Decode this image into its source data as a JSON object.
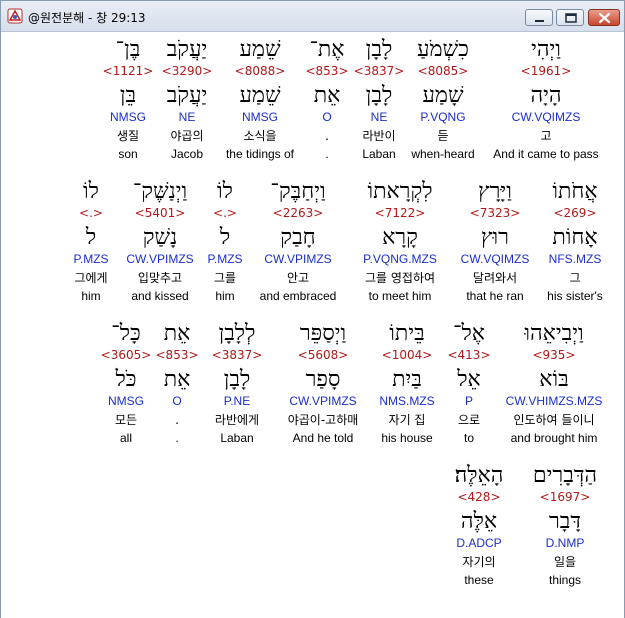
{
  "window": {
    "title": "@원전분해 - 창 29:13"
  },
  "rows": [
    {
      "words": [
        {
          "heb": "וַיְהִי",
          "strong": "<1961>",
          "lemma": "הָיָה",
          "parse": "CW.VQIMZS",
          "korean": "고",
          "english": "And it came to pass",
          "selected": true
        },
        {
          "heb": "כִשְׁמֹעַ",
          "strong": "<8085>",
          "lemma": "שָׁמַע",
          "parse": "P.VQNG",
          "korean": "듣",
          "english": "when-heard"
        },
        {
          "heb": "לָבָן",
          "strong": "<3837>",
          "lemma": "לָבָן",
          "parse": "NE",
          "korean": "라반이",
          "english": "Laban"
        },
        {
          "heb": "אֶת־",
          "strong": "<853>",
          "lemma": "אֵת",
          "parse": "O",
          "korean": ".",
          "english": "."
        },
        {
          "heb": "שֵׁמַע",
          "strong": "<8088>",
          "lemma": "שֵׁמַע",
          "parse": "NMSG",
          "korean": "소식을",
          "english": "the tidings of"
        },
        {
          "heb": "יַעֲקֹב",
          "strong": "<3290>",
          "lemma": "יַעֲקֹב",
          "parse": "NE",
          "korean": "야곱의",
          "english": "Jacob"
        },
        {
          "heb": "בֶּן־",
          "strong": "<1121>",
          "lemma": "בֵּן",
          "parse": "NMSG",
          "korean": "생질",
          "english": "son"
        }
      ]
    },
    {
      "words": [
        {
          "heb": "אֲחֹתוֹ",
          "strong": "<269>",
          "lemma": "אָחוֹת",
          "parse": "NFS.MZS",
          "korean": "그",
          "english": "his sister's"
        },
        {
          "heb": "וַיָּרָץ",
          "strong": "<7323>",
          "lemma": "רוּץ",
          "parse": "CW.VQIMZS",
          "korean": "달려와서",
          "english": "that he ran"
        },
        {
          "heb": "לִקְרָאתוֹ",
          "strong": "<7122>",
          "lemma": "קָרָא",
          "parse": "P.VQNG.MZS",
          "korean": "그를 영접하여",
          "english": "to meet him"
        },
        {
          "heb": "וַיְחַבֶּק־",
          "strong": "<2263>",
          "lemma": "חָבַק",
          "parse": "CW.VPIMZS",
          "korean": "안고",
          "english": "and embraced"
        },
        {
          "heb": "לוֹ",
          "strong": "<.>",
          "lemma": "ל",
          "parse": "P.MZS",
          "korean": "그를",
          "english": "him"
        },
        {
          "heb": "וַיְנַשֶּׁק־",
          "strong": "<5401>",
          "lemma": "נָשַׁק",
          "parse": "CW.VPIMZS",
          "korean": "입맞추고",
          "english": "and kissed"
        },
        {
          "heb": "לוֹ",
          "strong": "<.>",
          "lemma": "ל",
          "parse": "P.MZS",
          "korean": "그에게",
          "english": "him"
        }
      ]
    },
    {
      "words": [
        {
          "heb": "וַיְבִיאֵהוּ",
          "strong": "<935>",
          "lemma": "בּוֹא",
          "parse": "CW.VHIMZS.MZS",
          "korean": "인도하여 들이니",
          "english": "and brought him"
        },
        {
          "heb": "אֶל־",
          "strong": "<413>",
          "lemma": "אֵל",
          "parse": "P",
          "korean": "으로",
          "english": "to"
        },
        {
          "heb": "בֵּיתוֹ",
          "strong": "<1004>",
          "lemma": "בַּיִת",
          "parse": "NMS.MZS",
          "korean": "자기 집",
          "english": "his house"
        },
        {
          "heb": "וַיְסַפֵּר",
          "strong": "<5608>",
          "lemma": "סָפַר",
          "parse": "CW.VPIMZS",
          "korean": "야곱이-고하매",
          "english": "And he told"
        },
        {
          "heb": "לְלָבָן",
          "strong": "<3837>",
          "lemma": "לָבָן",
          "parse": "P.NE",
          "korean": "라반에게",
          "english": "Laban"
        },
        {
          "heb": "אֵת",
          "strong": "<853>",
          "lemma": "אֵת",
          "parse": "O",
          "korean": ".",
          "english": "."
        },
        {
          "heb": "כָּל־",
          "strong": "<3605>",
          "lemma": "כֹּל",
          "parse": "NMSG",
          "korean": "모든",
          "english": "all"
        }
      ]
    },
    {
      "words": [
        {
          "heb": "הַדְּבָרִים",
          "strong": "<1697>",
          "lemma": "דָּבָר",
          "parse": "D.NMP",
          "korean": "일을",
          "english": "things"
        },
        {
          "heb": "הָאֵלֶּה׃",
          "strong": "<428>",
          "lemma": "אֵלֶּה",
          "parse": "D.ADCP",
          "korean": "자기의",
          "english": "these"
        }
      ]
    }
  ]
}
